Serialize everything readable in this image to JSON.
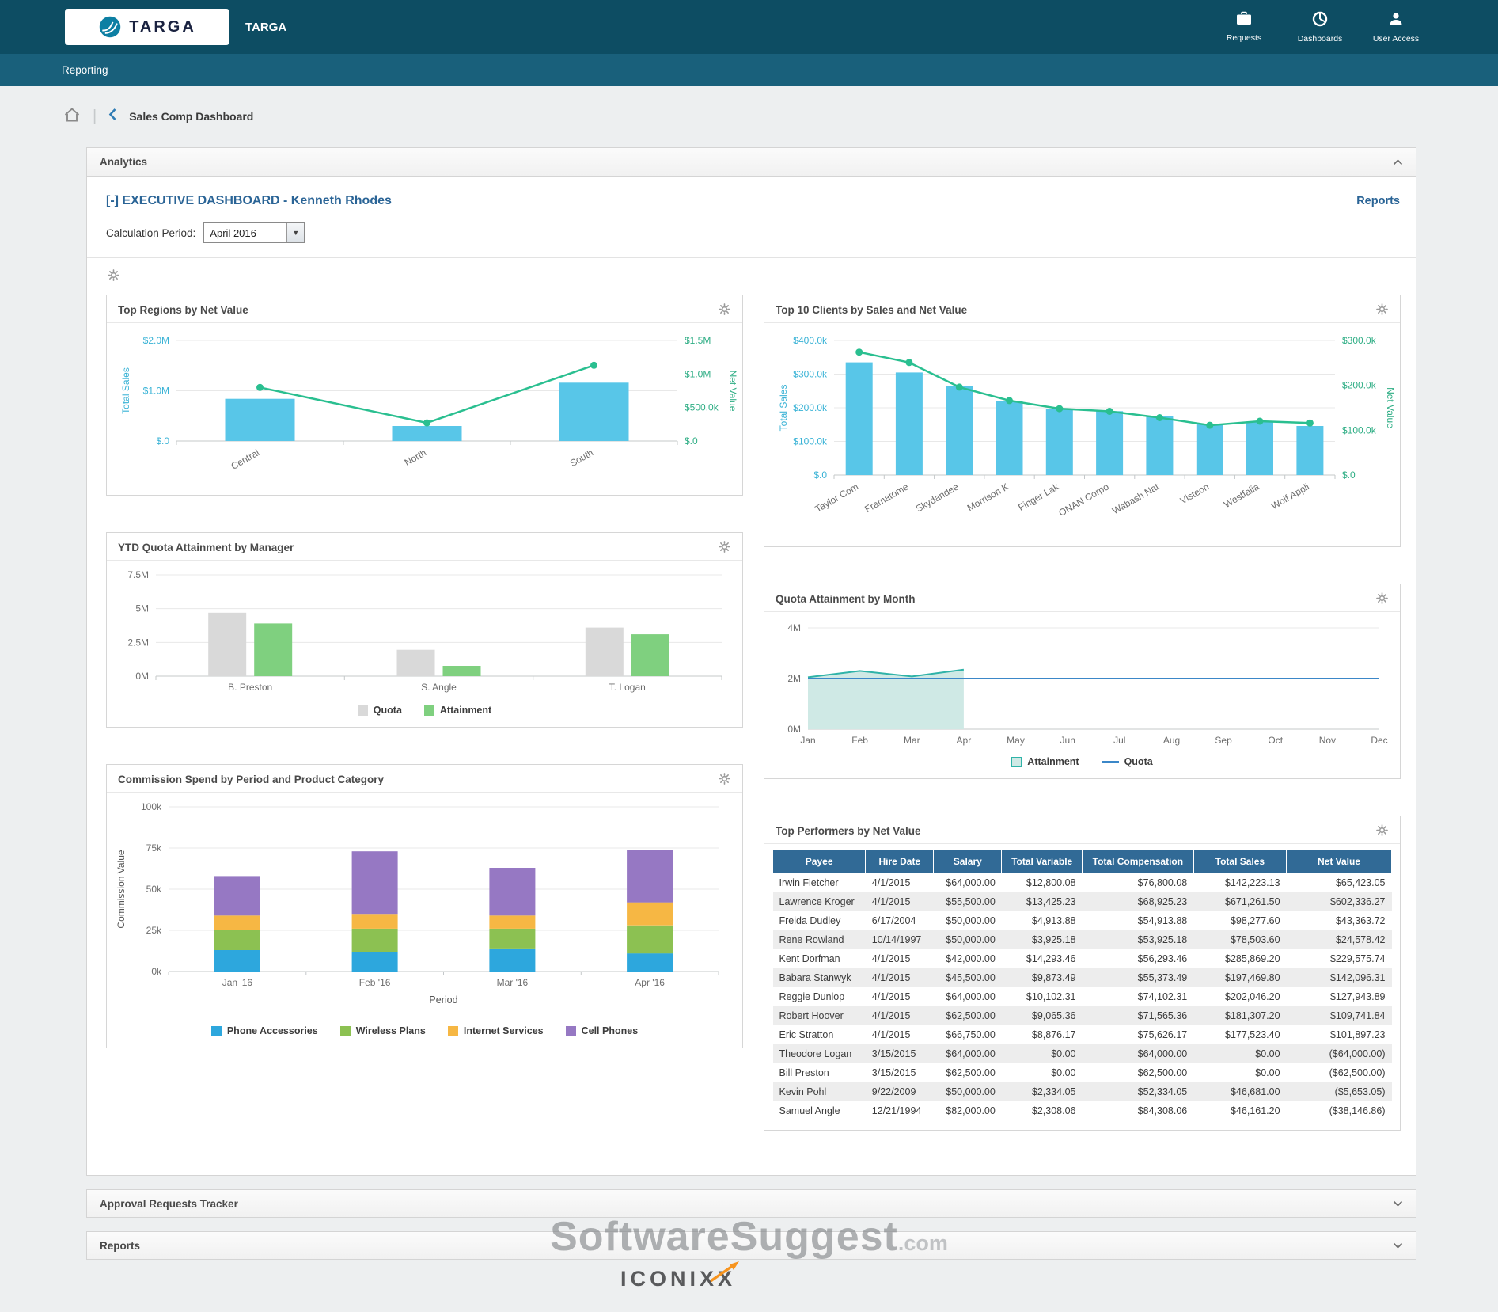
{
  "header": {
    "logo_text": "TARGA",
    "app_title": "TARGA",
    "nav_items": [
      {
        "label": "Requests",
        "icon": "requests-icon"
      },
      {
        "label": "Dashboards",
        "icon": "dashboards-icon"
      },
      {
        "label": "User Access",
        "icon": "user-access-icon"
      }
    ]
  },
  "subnav": {
    "label": "Reporting"
  },
  "breadcrumb": {
    "page_title": "Sales Comp Dashboard"
  },
  "analytics_panel": {
    "title": "Analytics"
  },
  "dashboard": {
    "title": "[-] EXECUTIVE DASHBOARD - Kenneth Rhodes",
    "reports_link": "Reports",
    "calculation_period_label": "Calculation Period:",
    "calculation_period_value": "April 2016"
  },
  "bottom_panels": [
    {
      "title": "Approval Requests Tracker"
    },
    {
      "title": "Reports"
    }
  ],
  "watermark": {
    "text": "SoftwareSuggest",
    "suffix": ".com"
  },
  "footer": {
    "logo_text": "ICONIXX"
  },
  "colors": {
    "header_bar": "#0d4d63",
    "subnav_bar": "#19607b",
    "accent_blue": "#2a6496",
    "bar_blue": "#58c6e8",
    "line_green": "#2abf90",
    "quota_gray": "#d9d9d9",
    "attainment_green": "#7fd07f",
    "table_header_blue": "#316a96"
  },
  "chart_data": [
    {
      "type": "bar",
      "title": "Top Regions by Net Value",
      "categories": [
        "Central",
        "North",
        "South"
      ],
      "series": [
        {
          "name": "Total Sales",
          "kind": "bar",
          "color": "#58c6e8",
          "values": [
            840000,
            300000,
            1160000
          ]
        },
        {
          "name": "Net Value",
          "kind": "line",
          "color": "#2abf90",
          "values": [
            800000,
            270000,
            1130000
          ]
        }
      ],
      "left_axis": {
        "label": "Total Sales",
        "color": "#3ab3d6",
        "ticks": [
          "$.0",
          "$1.0M",
          "$2.0M"
        ],
        "max": 2000000
      },
      "right_axis": {
        "label": "Net Value",
        "color": "#2fae85",
        "ticks": [
          "$.0",
          "$500.0k",
          "$1.0M",
          "$1.5M"
        ],
        "max": 1500000
      }
    },
    {
      "type": "bar",
      "title": "Top 10 Clients by Sales and Net Value",
      "categories": [
        "Taylor Com",
        "Framatome",
        "Skydandee",
        "Morrison K",
        "Finger Lak",
        "ONAN Corpo",
        "Wabash Nat",
        "Visteon",
        "Westfalia",
        "Wolf Appli"
      ],
      "series": [
        {
          "name": "Total Sales",
          "kind": "bar",
          "color": "#58c6e8",
          "values": [
            335000,
            305000,
            264000,
            219000,
            196000,
            190000,
            174000,
            151000,
            159000,
            146000
          ]
        },
        {
          "name": "Net Value",
          "kind": "line",
          "color": "#2abf90",
          "values": [
            274000,
            251000,
            196000,
            166000,
            148000,
            142000,
            128000,
            111000,
            120000,
            116000
          ]
        }
      ],
      "left_axis": {
        "label": "Total Sales",
        "color": "#3ab3d6",
        "ticks": [
          "$.0",
          "$100.0k",
          "$200.0k",
          "$300.0k",
          "$400.0k"
        ],
        "max": 400000
      },
      "right_axis": {
        "label": "Net Value",
        "color": "#2fae85",
        "ticks": [
          "$.0",
          "$100.0k",
          "$200.0k",
          "$300.0k"
        ],
        "max": 300000
      }
    },
    {
      "type": "bar",
      "title": "YTD Quota Attainment by Manager",
      "categories": [
        "B. Preston",
        "S. Angle",
        "T. Logan"
      ],
      "series": [
        {
          "name": "Quota",
          "color": "#d9d9d9",
          "values": [
            4700000,
            1950000,
            3600000
          ]
        },
        {
          "name": "Attainment",
          "color": "#7fd07f",
          "values": [
            3900000,
            760000,
            3100000
          ]
        }
      ],
      "y_axis": {
        "ticks": [
          "0M",
          "2.5M",
          "5M",
          "7.5M"
        ],
        "max": 7500000
      },
      "legend": [
        "Quota",
        "Attainment"
      ]
    },
    {
      "type": "area",
      "title": "Quota Attainment by Month",
      "categories": [
        "Jan",
        "Feb",
        "Mar",
        "Apr",
        "May",
        "Jun",
        "Jul",
        "Aug",
        "Sep",
        "Oct",
        "Nov",
        "Dec"
      ],
      "series": [
        {
          "name": "Attainment",
          "kind": "area",
          "color": "#cfe9e5",
          "stroke": "#2fb3a8",
          "values": [
            2050000,
            2300000,
            2080000,
            2350000,
            null,
            null,
            null,
            null,
            null,
            null,
            null,
            null
          ]
        },
        {
          "name": "Quota",
          "kind": "line",
          "color": "#3b87c8",
          "values": [
            2000000,
            2000000,
            2000000,
            2000000,
            2000000,
            2000000,
            2000000,
            2000000,
            2000000,
            2000000,
            2000000,
            2000000
          ]
        }
      ],
      "y_axis": {
        "ticks": [
          "0M",
          "2M",
          "4M"
        ],
        "max": 4000000
      },
      "legend": [
        "Attainment",
        "Quota"
      ]
    },
    {
      "type": "bar",
      "stacked": true,
      "title": "Commission Spend by Period and Product Category",
      "categories": [
        "Jan '16",
        "Feb '16",
        "Mar '16",
        "Apr '16"
      ],
      "series": [
        {
          "name": "Phone Accessories",
          "color": "#2da7dd",
          "values": [
            13000,
            12000,
            14000,
            11000
          ]
        },
        {
          "name": "Wireless Plans",
          "color": "#8cc152",
          "values": [
            12000,
            14000,
            12000,
            17000
          ]
        },
        {
          "name": "Internet Services",
          "color": "#f6b744",
          "values": [
            9000,
            9000,
            8000,
            14000
          ]
        },
        {
          "name": "Cell Phones",
          "color": "#9678c3",
          "values": [
            24000,
            38000,
            29000,
            32000
          ]
        }
      ],
      "xlabel": "Period",
      "ylabel": "Commission Value",
      "y_axis": {
        "ticks": [
          "0k",
          "25k",
          "50k",
          "75k",
          "100k"
        ],
        "max": 100000
      }
    },
    {
      "type": "table",
      "title": "Top Performers by Net Value",
      "columns": [
        "Payee",
        "Hire Date",
        "Salary",
        "Total Variable",
        "Total Compensation",
        "Total Sales",
        "Net Value"
      ],
      "rows": [
        [
          "Irwin Fletcher",
          "4/1/2015",
          "$64,000.00",
          "$12,800.08",
          "$76,800.08",
          "$142,223.13",
          "$65,423.05"
        ],
        [
          "Lawrence Kroger",
          "4/1/2015",
          "$55,500.00",
          "$13,425.23",
          "$68,925.23",
          "$671,261.50",
          "$602,336.27"
        ],
        [
          "Freida Dudley",
          "6/17/2004",
          "$50,000.00",
          "$4,913.88",
          "$54,913.88",
          "$98,277.60",
          "$43,363.72"
        ],
        [
          "Rene Rowland",
          "10/14/1997",
          "$50,000.00",
          "$3,925.18",
          "$53,925.18",
          "$78,503.60",
          "$24,578.42"
        ],
        [
          "Kent Dorfman",
          "4/1/2015",
          "$42,000.00",
          "$14,293.46",
          "$56,293.46",
          "$285,869.20",
          "$229,575.74"
        ],
        [
          "Babara Stanwyk",
          "4/1/2015",
          "$45,500.00",
          "$9,873.49",
          "$55,373.49",
          "$197,469.80",
          "$142,096.31"
        ],
        [
          "Reggie Dunlop",
          "4/1/2015",
          "$64,000.00",
          "$10,102.31",
          "$74,102.31",
          "$202,046.20",
          "$127,943.89"
        ],
        [
          "Robert Hoover",
          "4/1/2015",
          "$62,500.00",
          "$9,065.36",
          "$71,565.36",
          "$181,307.20",
          "$109,741.84"
        ],
        [
          "Eric Stratton",
          "4/1/2015",
          "$66,750.00",
          "$8,876.17",
          "$75,626.17",
          "$177,523.40",
          "$101,897.23"
        ],
        [
          "Theodore Logan",
          "3/15/2015",
          "$64,000.00",
          "$0.00",
          "$64,000.00",
          "$0.00",
          "($64,000.00)"
        ],
        [
          "Bill Preston",
          "3/15/2015",
          "$62,500.00",
          "$0.00",
          "$62,500.00",
          "$0.00",
          "($62,500.00)"
        ],
        [
          "Kevin Pohl",
          "9/22/2009",
          "$50,000.00",
          "$2,334.05",
          "$52,334.05",
          "$46,681.00",
          "($5,653.05)"
        ],
        [
          "Samuel Angle",
          "12/21/1994",
          "$82,000.00",
          "$2,308.06",
          "$84,308.06",
          "$46,161.20",
          "($38,146.86)"
        ]
      ]
    }
  ]
}
